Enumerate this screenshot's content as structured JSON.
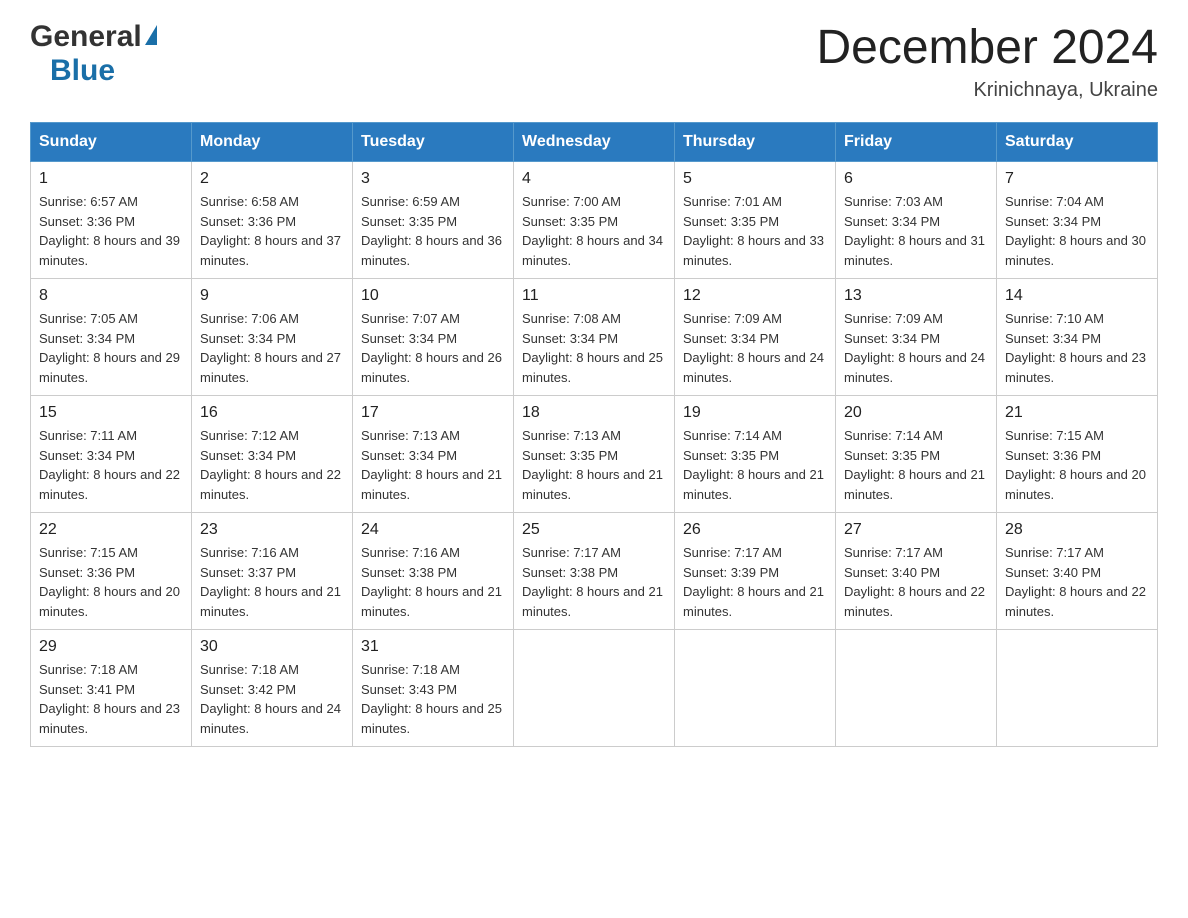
{
  "header": {
    "logo_general": "General",
    "logo_blue": "Blue",
    "month_title": "December 2024",
    "location": "Krinichnaya, Ukraine"
  },
  "weekdays": [
    "Sunday",
    "Monday",
    "Tuesday",
    "Wednesday",
    "Thursday",
    "Friday",
    "Saturday"
  ],
  "weeks": [
    [
      {
        "day": "1",
        "sunrise": "Sunrise: 6:57 AM",
        "sunset": "Sunset: 3:36 PM",
        "daylight": "Daylight: 8 hours and 39 minutes."
      },
      {
        "day": "2",
        "sunrise": "Sunrise: 6:58 AM",
        "sunset": "Sunset: 3:36 PM",
        "daylight": "Daylight: 8 hours and 37 minutes."
      },
      {
        "day": "3",
        "sunrise": "Sunrise: 6:59 AM",
        "sunset": "Sunset: 3:35 PM",
        "daylight": "Daylight: 8 hours and 36 minutes."
      },
      {
        "day": "4",
        "sunrise": "Sunrise: 7:00 AM",
        "sunset": "Sunset: 3:35 PM",
        "daylight": "Daylight: 8 hours and 34 minutes."
      },
      {
        "day": "5",
        "sunrise": "Sunrise: 7:01 AM",
        "sunset": "Sunset: 3:35 PM",
        "daylight": "Daylight: 8 hours and 33 minutes."
      },
      {
        "day": "6",
        "sunrise": "Sunrise: 7:03 AM",
        "sunset": "Sunset: 3:34 PM",
        "daylight": "Daylight: 8 hours and 31 minutes."
      },
      {
        "day": "7",
        "sunrise": "Sunrise: 7:04 AM",
        "sunset": "Sunset: 3:34 PM",
        "daylight": "Daylight: 8 hours and 30 minutes."
      }
    ],
    [
      {
        "day": "8",
        "sunrise": "Sunrise: 7:05 AM",
        "sunset": "Sunset: 3:34 PM",
        "daylight": "Daylight: 8 hours and 29 minutes."
      },
      {
        "day": "9",
        "sunrise": "Sunrise: 7:06 AM",
        "sunset": "Sunset: 3:34 PM",
        "daylight": "Daylight: 8 hours and 27 minutes."
      },
      {
        "day": "10",
        "sunrise": "Sunrise: 7:07 AM",
        "sunset": "Sunset: 3:34 PM",
        "daylight": "Daylight: 8 hours and 26 minutes."
      },
      {
        "day": "11",
        "sunrise": "Sunrise: 7:08 AM",
        "sunset": "Sunset: 3:34 PM",
        "daylight": "Daylight: 8 hours and 25 minutes."
      },
      {
        "day": "12",
        "sunrise": "Sunrise: 7:09 AM",
        "sunset": "Sunset: 3:34 PM",
        "daylight": "Daylight: 8 hours and 24 minutes."
      },
      {
        "day": "13",
        "sunrise": "Sunrise: 7:09 AM",
        "sunset": "Sunset: 3:34 PM",
        "daylight": "Daylight: 8 hours and 24 minutes."
      },
      {
        "day": "14",
        "sunrise": "Sunrise: 7:10 AM",
        "sunset": "Sunset: 3:34 PM",
        "daylight": "Daylight: 8 hours and 23 minutes."
      }
    ],
    [
      {
        "day": "15",
        "sunrise": "Sunrise: 7:11 AM",
        "sunset": "Sunset: 3:34 PM",
        "daylight": "Daylight: 8 hours and 22 minutes."
      },
      {
        "day": "16",
        "sunrise": "Sunrise: 7:12 AM",
        "sunset": "Sunset: 3:34 PM",
        "daylight": "Daylight: 8 hours and 22 minutes."
      },
      {
        "day": "17",
        "sunrise": "Sunrise: 7:13 AM",
        "sunset": "Sunset: 3:34 PM",
        "daylight": "Daylight: 8 hours and 21 minutes."
      },
      {
        "day": "18",
        "sunrise": "Sunrise: 7:13 AM",
        "sunset": "Sunset: 3:35 PM",
        "daylight": "Daylight: 8 hours and 21 minutes."
      },
      {
        "day": "19",
        "sunrise": "Sunrise: 7:14 AM",
        "sunset": "Sunset: 3:35 PM",
        "daylight": "Daylight: 8 hours and 21 minutes."
      },
      {
        "day": "20",
        "sunrise": "Sunrise: 7:14 AM",
        "sunset": "Sunset: 3:35 PM",
        "daylight": "Daylight: 8 hours and 21 minutes."
      },
      {
        "day": "21",
        "sunrise": "Sunrise: 7:15 AM",
        "sunset": "Sunset: 3:36 PM",
        "daylight": "Daylight: 8 hours and 20 minutes."
      }
    ],
    [
      {
        "day": "22",
        "sunrise": "Sunrise: 7:15 AM",
        "sunset": "Sunset: 3:36 PM",
        "daylight": "Daylight: 8 hours and 20 minutes."
      },
      {
        "day": "23",
        "sunrise": "Sunrise: 7:16 AM",
        "sunset": "Sunset: 3:37 PM",
        "daylight": "Daylight: 8 hours and 21 minutes."
      },
      {
        "day": "24",
        "sunrise": "Sunrise: 7:16 AM",
        "sunset": "Sunset: 3:38 PM",
        "daylight": "Daylight: 8 hours and 21 minutes."
      },
      {
        "day": "25",
        "sunrise": "Sunrise: 7:17 AM",
        "sunset": "Sunset: 3:38 PM",
        "daylight": "Daylight: 8 hours and 21 minutes."
      },
      {
        "day": "26",
        "sunrise": "Sunrise: 7:17 AM",
        "sunset": "Sunset: 3:39 PM",
        "daylight": "Daylight: 8 hours and 21 minutes."
      },
      {
        "day": "27",
        "sunrise": "Sunrise: 7:17 AM",
        "sunset": "Sunset: 3:40 PM",
        "daylight": "Daylight: 8 hours and 22 minutes."
      },
      {
        "day": "28",
        "sunrise": "Sunrise: 7:17 AM",
        "sunset": "Sunset: 3:40 PM",
        "daylight": "Daylight: 8 hours and 22 minutes."
      }
    ],
    [
      {
        "day": "29",
        "sunrise": "Sunrise: 7:18 AM",
        "sunset": "Sunset: 3:41 PM",
        "daylight": "Daylight: 8 hours and 23 minutes."
      },
      {
        "day": "30",
        "sunrise": "Sunrise: 7:18 AM",
        "sunset": "Sunset: 3:42 PM",
        "daylight": "Daylight: 8 hours and 24 minutes."
      },
      {
        "day": "31",
        "sunrise": "Sunrise: 7:18 AM",
        "sunset": "Sunset: 3:43 PM",
        "daylight": "Daylight: 8 hours and 25 minutes."
      },
      null,
      null,
      null,
      null
    ]
  ]
}
